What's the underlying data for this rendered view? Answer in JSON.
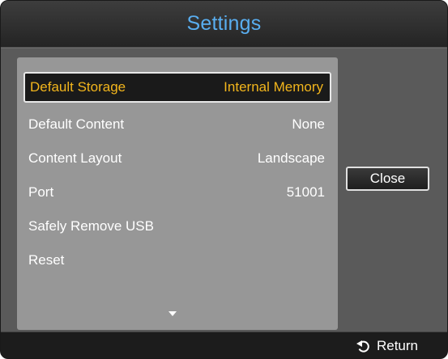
{
  "window": {
    "title": "Settings"
  },
  "settings": {
    "items": [
      {
        "label": "Default Storage",
        "value": "Internal Memory"
      },
      {
        "label": "Default Content",
        "value": "None"
      },
      {
        "label": "Content Layout",
        "value": "Landscape"
      },
      {
        "label": "Port",
        "value": "51001"
      },
      {
        "label": "Safely Remove USB",
        "value": ""
      },
      {
        "label": "Reset",
        "value": ""
      }
    ]
  },
  "buttons": {
    "close_label": "Close"
  },
  "footer": {
    "return_label": "Return",
    "return_icon": "return-arrow-icon"
  },
  "colors": {
    "title": "#59aef0",
    "selected_text": "#f2b51c",
    "panel": "#979797"
  }
}
